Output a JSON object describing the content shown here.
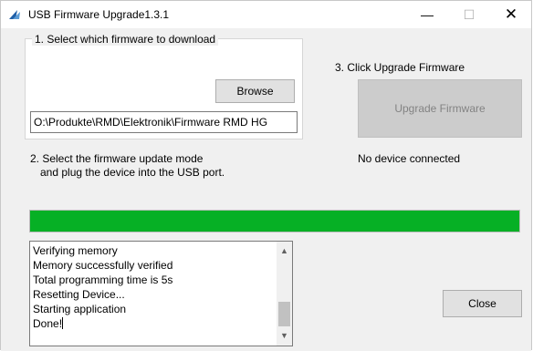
{
  "window": {
    "title": "USB Firmware Upgrade1.3.1",
    "minimize_glyph": "—",
    "maximize_glyph": "☐",
    "close_glyph": "✕"
  },
  "step1": {
    "label": "1. Select which firmware to download",
    "browse_label": "Browse",
    "path_value": "O:\\Produkte\\RMD\\Elektronik\\Firmware RMD HG"
  },
  "step3": {
    "label": "3. Click Upgrade Firmware",
    "upgrade_label": "Upgrade Firmware"
  },
  "step2": {
    "line1": "2. Select the firmware update mode",
    "line2": "and plug the device into the USB port."
  },
  "status": {
    "device": "No device connected"
  },
  "progress": {
    "fraction": 1.0,
    "color": "#06b025"
  },
  "log": {
    "lines": [
      "Verifying memory",
      "Memory successfully verified",
      "Total programming time is 5s",
      "Resetting Device...",
      "Starting application",
      "Done!"
    ],
    "scroll_up_glyph": "▲",
    "scroll_down_glyph": "▼"
  },
  "actions": {
    "close_label": "Close"
  },
  "icons": {
    "app": "usb-upgrade-app-icon"
  }
}
